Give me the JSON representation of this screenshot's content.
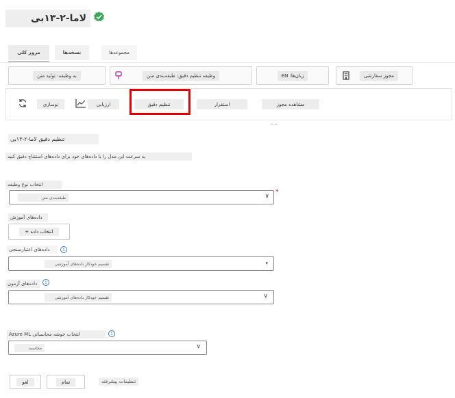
{
  "header": {
    "title": "لاما-۲-۱۳بی"
  },
  "tabs": [
    {
      "label": "مرور کلی"
    },
    {
      "label": "نسخه‌ها"
    },
    {
      "label": "مجموعه‌ها"
    }
  ],
  "cards": {
    "task": "به وظیفه: تولید متن",
    "finetune_task": "وظیفه تنظیم دقیق: طبقه‌بندی متن",
    "languages": "زبان‌ها: EN",
    "license": "مجوز سفارشی"
  },
  "toolbar": {
    "finetune": "تنظیم دقیق",
    "deploy": "استقرار",
    "view_license": "مشاهده مجوز",
    "evaluate": "ارزیابی",
    "refresh": "نوسازی"
  },
  "form": {
    "title": "تنظیم دقیق لاما-۲-۱۳بی",
    "description": "به سرعت این مدل را با داده‌های خود برای داده‌های استنتاج دقیق کنید",
    "task_type_label": "انتخاب نوع وظیفه",
    "task_type_value": "طبقه‌بندی متن",
    "train_data_label": "داده‌های آموزش",
    "train_data_button": "+ انتخاب داده",
    "validation_label": "داده‌های اعتبارسنجی",
    "validation_value": "تقسیم خودکار داده‌های آموزشی",
    "test_label": "داده‌های آزمون",
    "test_value": "تقسیم خودکار داده‌های آموزشی",
    "compute_label": "انتخاب خوشه محاسباتی Azure ML",
    "compute_value": "محاسبه"
  },
  "footer": {
    "advanced": "تنظیمات پیشرفته",
    "finish": "تمام",
    "cancel": "لغو"
  },
  "colors": {
    "highlight": "#e30000",
    "verified": "#3aa657",
    "info": "#3a7bd5"
  }
}
